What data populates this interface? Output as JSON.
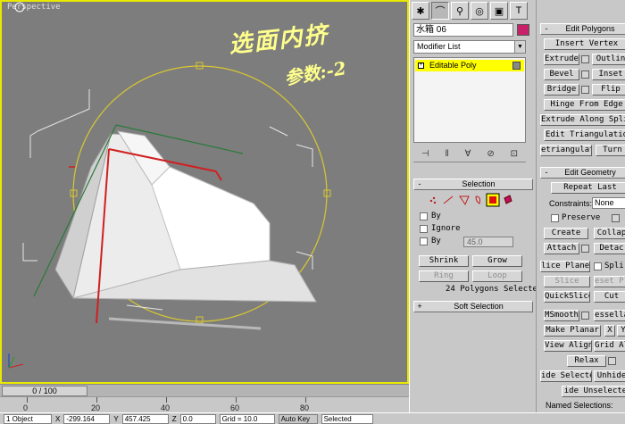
{
  "viewport": {
    "label": "Perspective",
    "annotation_line1": "选面内挤",
    "annotation_line2": "参数:-2"
  },
  "timeline": {
    "slider": "0 / 100",
    "ticks": [
      "0",
      "20",
      "40",
      "60",
      "80"
    ]
  },
  "statusbar": {
    "selected_label": "1 Object",
    "x_value": "-299.164",
    "y_value": "457.425",
    "z_value": "0.0",
    "grid": "Grid = 10.0",
    "auto_key": "Auto Key",
    "set_key_mode": "Selected"
  },
  "command_panel": {
    "tabs": [
      "create-tab",
      "modify-tab",
      "hierarchy-tab",
      "motion-tab",
      "display-tab",
      "utilities-tab"
    ],
    "object_name": "水箱    06",
    "object_color": "#c8216a",
    "modifier_list": "Modifier List",
    "stack_item": "Editable Poly",
    "selection": {
      "title": "Selection",
      "by_vertex": "By",
      "ignore": "Ignore",
      "by_angle": "By",
      "angle_value": "45.0",
      "shrink": "Shrink",
      "grow": "Grow",
      "ring": "Ring",
      "loop": "Loop",
      "status": "24 Polygons Selected"
    },
    "soft_selection": "Soft Selection"
  },
  "right_panel": {
    "edit_polygons": {
      "title": "Edit Polygons",
      "insert_vertex": "Insert Vertex",
      "extrude": "Extrude",
      "outline": "Outlin",
      "bevel": "Bevel",
      "inset": "Inset",
      "bridge": "Bridge",
      "flip": "Flip",
      "hinge": "Hinge From Edge",
      "extrude_spline": "Extrude Along Splin",
      "edit_tri": "Edit Triangulatio",
      "retriangulate": "etriangulat",
      "turn": "Turn"
    },
    "edit_geometry": {
      "title": "Edit Geometry",
      "repeat_last": "Repeat Last",
      "constraints_label": "Constraints:",
      "constraints_value": "None",
      "preserve": "Preserve",
      "create": "Create",
      "collapse": "Collap",
      "attach": "Attach",
      "detach": "Detac",
      "slice_plane": "lice Plane",
      "split": "Spli",
      "slice": "Slice",
      "reset_plane": "eset Pl",
      "quickslice": "QuickSlice",
      "cut": "Cut",
      "msmooth": "MSmooth",
      "tessellate": "essella",
      "make_planar": "Make Planar",
      "x": "X",
      "y": "Y",
      "view_align": "View Align",
      "grid_align": "Grid Al",
      "relax": "Relax",
      "hide_selected": "ide Selecte",
      "unhide": "Unhide",
      "hide_unselected": "ide Unselecte",
      "named_selections": "Named Selections:"
    }
  }
}
